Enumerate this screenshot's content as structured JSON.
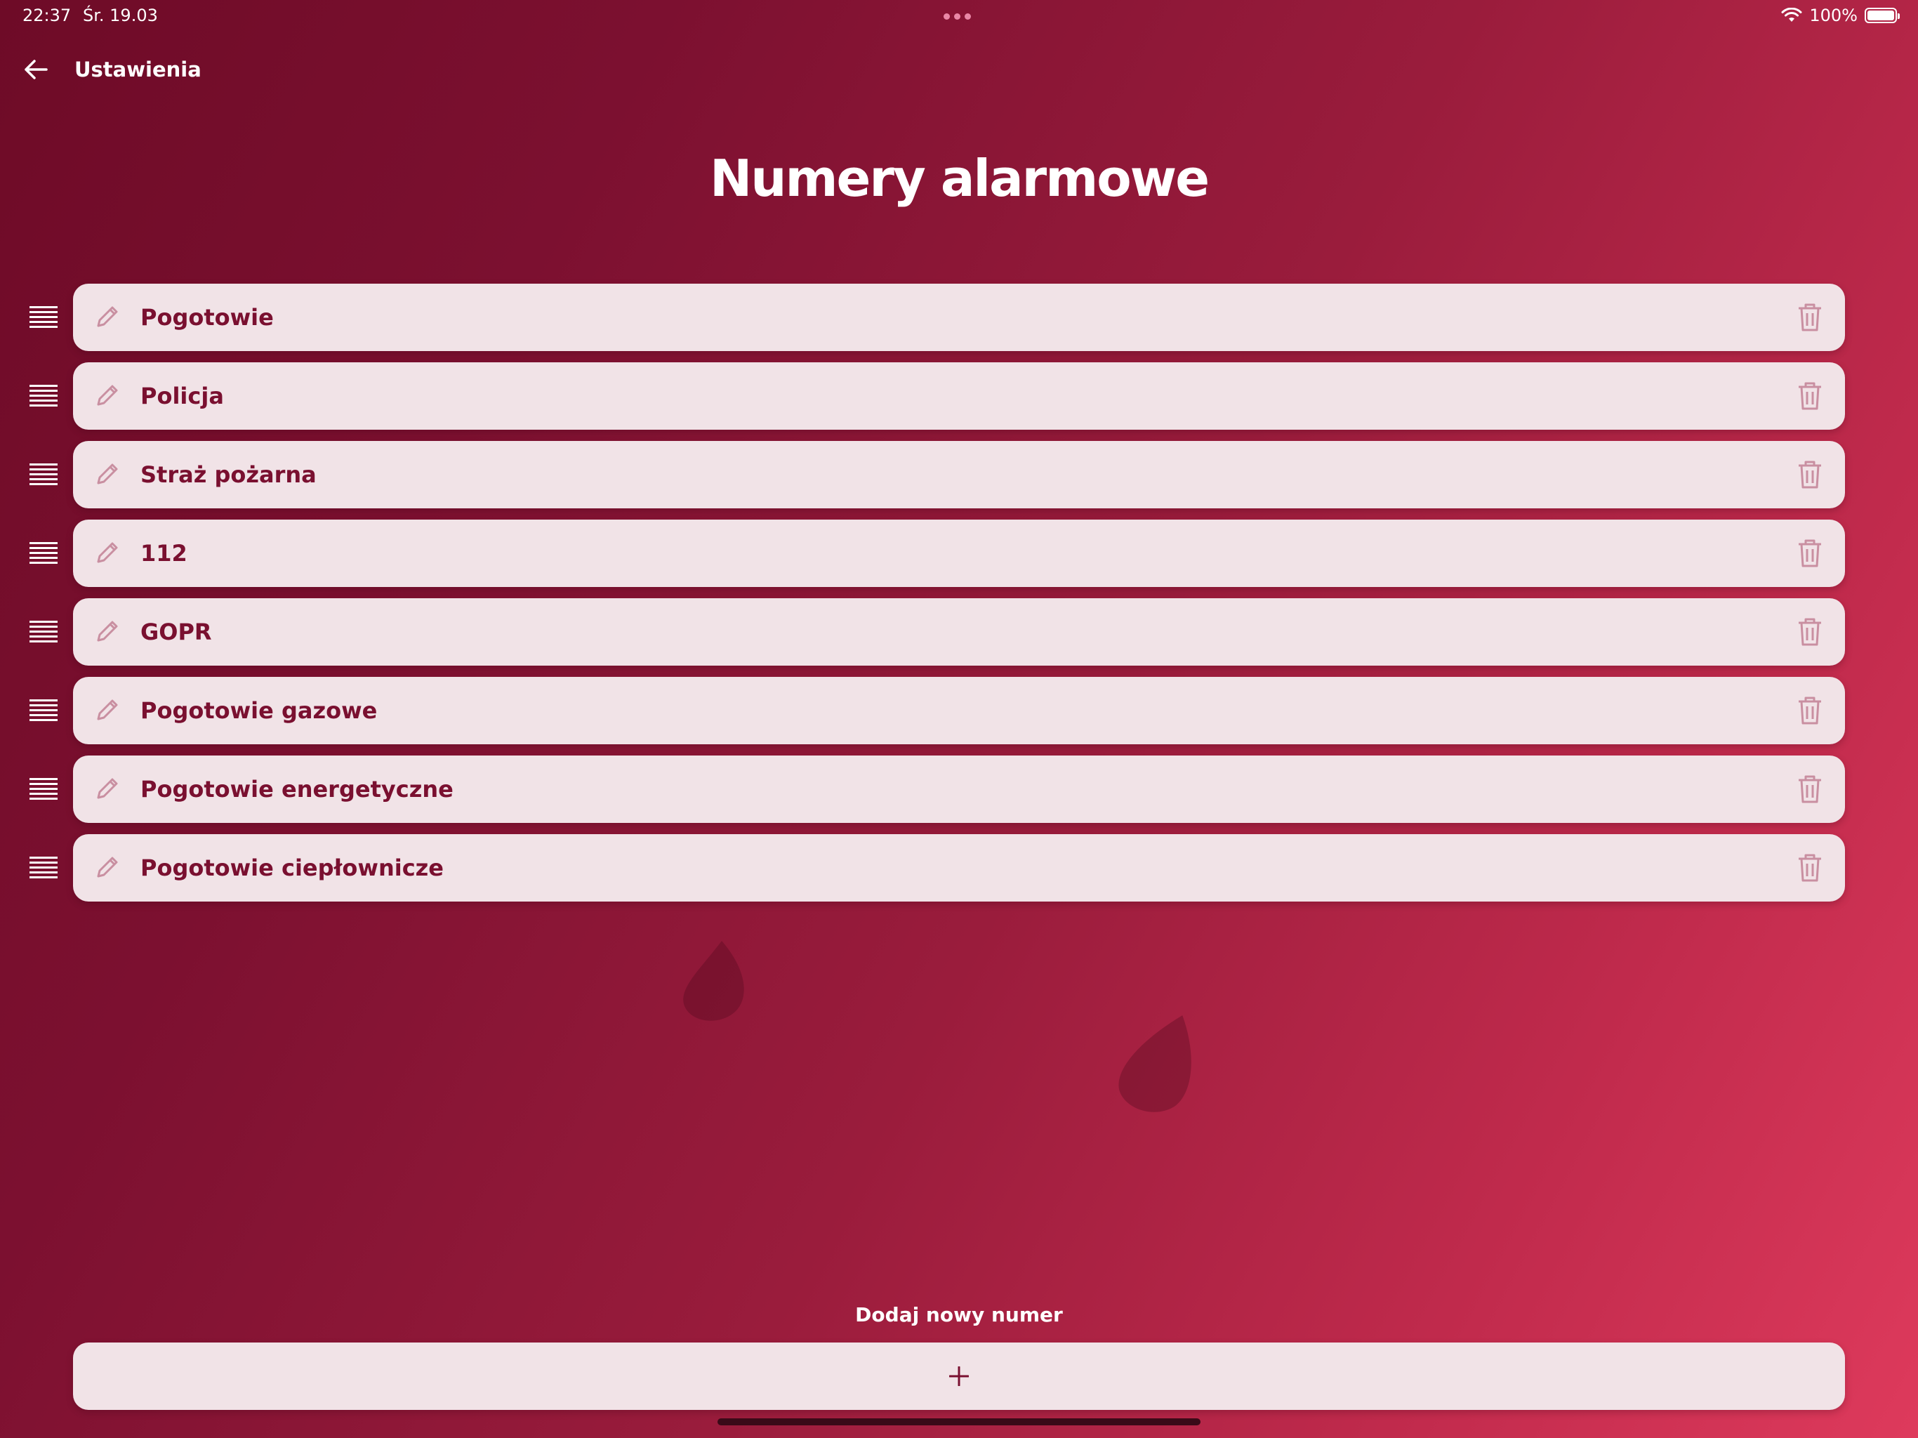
{
  "status_bar": {
    "time": "22:37",
    "date": "Śr. 19.03",
    "battery": "100%",
    "icons": [
      "wifi-icon",
      "battery-icon"
    ]
  },
  "nav": {
    "back_icon": "arrow-left-icon",
    "back_label": "Ustawienia"
  },
  "page": {
    "title": "Numery alarmowe"
  },
  "numbers": [
    {
      "label": "Pogotowie"
    },
    {
      "label": "Policja"
    },
    {
      "label": "Straż pożarna"
    },
    {
      "label": "112"
    },
    {
      "label": "GOPR"
    },
    {
      "label": "Pogotowie gazowe"
    },
    {
      "label": "Pogotowie energetyczne"
    },
    {
      "label": "Pogotowie ciepłownicze"
    }
  ],
  "row_icons": {
    "drag": "drag-handle-icon",
    "edit": "pencil-icon",
    "delete": "trash-icon"
  },
  "add": {
    "label": "Dodaj nowy numer",
    "button_icon": "plus-icon"
  },
  "colors": {
    "gradient_start": "#6e0b27",
    "gradient_end": "#de3a5c",
    "card_background": "#f1e3e7",
    "label_text": "#7a1030",
    "icon_muted": "#c98fa1"
  }
}
